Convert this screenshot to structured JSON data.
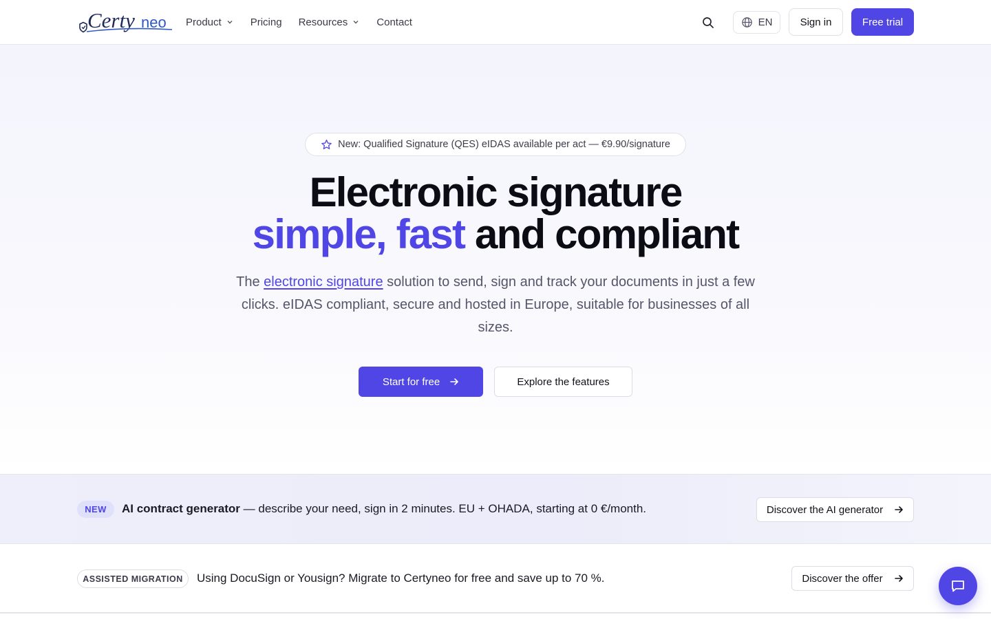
{
  "brand": {
    "name": "Certyneo",
    "part1": "Certy",
    "part2": "neo",
    "accent": "#4f46e5"
  },
  "nav": {
    "items": [
      {
        "label": "Product",
        "has_dropdown": true
      },
      {
        "label": "Pricing",
        "has_dropdown": false
      },
      {
        "label": "Resources",
        "has_dropdown": true
      },
      {
        "label": "Contact",
        "has_dropdown": false
      }
    ],
    "language": "EN",
    "signin_label": "Sign in",
    "trial_label": "Free trial"
  },
  "hero": {
    "badge": "New: Qualified Signature (QES) eIDAS available per act — €9.90/signature",
    "title_line1": "Electronic signature",
    "title_accent": "simple, fast",
    "title_rest": " and compliant",
    "subtitle_before": "The ",
    "subtitle_link": "electronic signature",
    "subtitle_after": " solution to send, sign and track your documents in just a few clicks. eIDAS compliant, secure and hosted in Europe, suitable for businesses of all sizes.",
    "cta_primary": "Start for free",
    "cta_secondary": "Explore the features"
  },
  "ai_banner": {
    "tag": "NEW",
    "strong": "AI contract generator",
    "text": " — describe your need, sign in 2 minutes. EU + OHADA, starting at 0 €/month.",
    "button": "Discover the AI generator"
  },
  "migration_banner": {
    "tag": "ASSISTED MIGRATION",
    "text": "Using DocuSign or Yousign? Migrate to Certyneo for free and save up to 70 %.",
    "button": "Discover the offer"
  },
  "icons": {
    "search": "search-icon",
    "language": "globe-icon",
    "badge": "star-icon",
    "arrow": "arrow-right-icon",
    "chat": "chat-bubble-icon"
  }
}
